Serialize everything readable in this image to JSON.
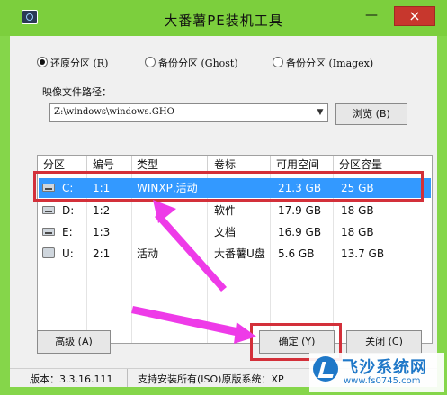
{
  "window": {
    "title": "大番薯PE装机工具",
    "minimize": "—",
    "close": "×"
  },
  "mode_options": [
    {
      "label": "还原分区 (R)",
      "selected": true
    },
    {
      "label": "备份分区 (Ghost)",
      "selected": false
    },
    {
      "label": "备份分区 (Imagex)",
      "selected": false
    }
  ],
  "image_path": {
    "label": "映像文件路径：",
    "value": "Z:\\windows\\windows.GHO",
    "browse": "浏览 (B)"
  },
  "table": {
    "columns": [
      "分区",
      "编号",
      "类型",
      "卷标",
      "可用空间",
      "分区容量"
    ],
    "rows": [
      {
        "drive": "C:",
        "number": "1:1",
        "type": "WINXP,活动",
        "label": "",
        "free": "21.3 GB",
        "capacity": "25 GB",
        "icon": "disk-icon",
        "selected": true
      },
      {
        "drive": "D:",
        "number": "1:2",
        "type": "",
        "label": "软件",
        "free": "17.9 GB",
        "capacity": "18 GB",
        "icon": "disk-icon",
        "selected": false
      },
      {
        "drive": "E:",
        "number": "1:3",
        "type": "",
        "label": "文档",
        "free": "16.9 GB",
        "capacity": "18 GB",
        "icon": "disk-icon",
        "selected": false
      },
      {
        "drive": "U:",
        "number": "2:1",
        "type": "活动",
        "label": "大番薯U盘",
        "free": "5.6 GB",
        "capacity": "13.7 GB",
        "icon": "usb-drive-icon",
        "selected": false
      }
    ]
  },
  "buttons": {
    "advanced": "高级 (A)",
    "ok": "确定 (Y)",
    "close": "关闭 (C)"
  },
  "status": {
    "version": "版本：3.3.16.111",
    "support": "支持安装所有(ISO)原版系统：XP"
  },
  "watermark": {
    "title": "飞沙系统网",
    "url": "www.fs0745.com"
  },
  "colors": {
    "title_bg": "#7ccf3d",
    "selection": "#3399ff",
    "highlight_box": "#d3303a",
    "arrow": "#ee3be8"
  }
}
